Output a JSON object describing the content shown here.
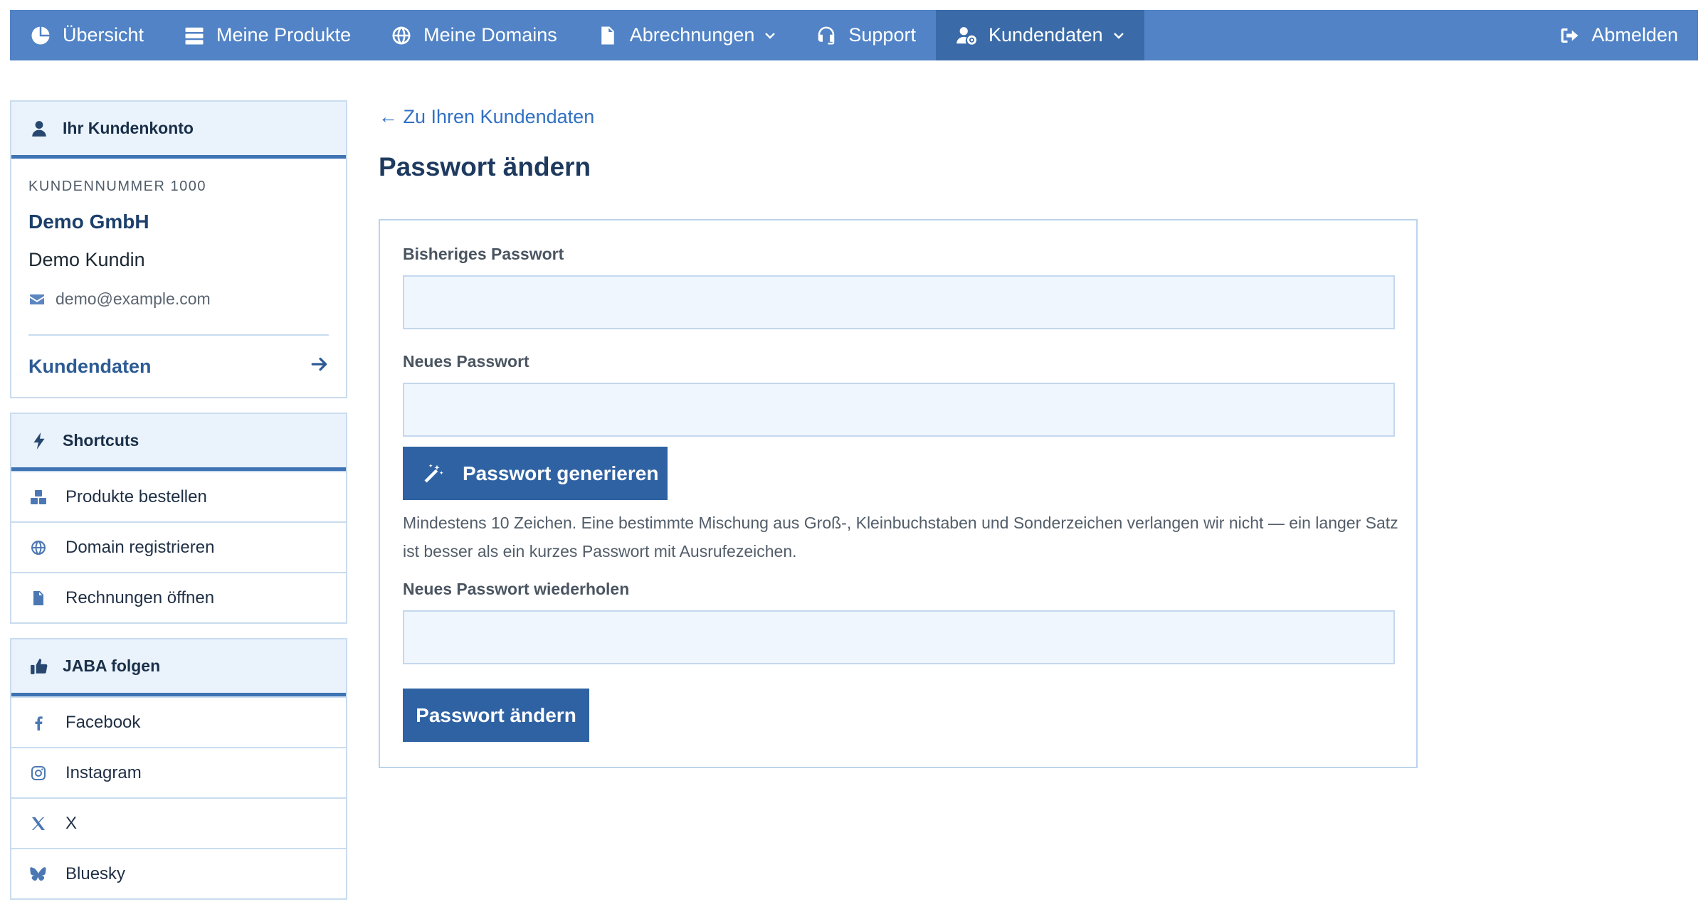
{
  "nav": {
    "items": [
      {
        "label": "Übersicht",
        "icon": "chart-pie-icon"
      },
      {
        "label": "Meine Produkte",
        "icon": "server-icon"
      },
      {
        "label": "Meine Domains",
        "icon": "globe-icon"
      },
      {
        "label": "Abrechnungen",
        "icon": "document-icon",
        "dropdown": true
      },
      {
        "label": "Support",
        "icon": "headset-icon"
      },
      {
        "label": "Kundendaten",
        "icon": "user-gear-icon",
        "dropdown": true,
        "active": true
      }
    ],
    "logout_label": "Abmelden",
    "bg_color": "#5183c6",
    "active_color": "#3a6ba8"
  },
  "sidebar": {
    "account": {
      "heading": "Ihr Kundenkonto",
      "customer_number": "KUNDENNUMMER 1000",
      "company": "Demo GmbH",
      "person": "Demo Kundin",
      "email": "demo@example.com",
      "link_label": "Kundendaten"
    },
    "shortcuts": {
      "heading": "Shortcuts",
      "items": [
        {
          "label": "Produkte bestellen",
          "icon": "boxes-icon"
        },
        {
          "label": "Domain registrieren",
          "icon": "globe-icon"
        },
        {
          "label": "Rechnungen öffnen",
          "icon": "document-icon"
        }
      ]
    },
    "social": {
      "heading": "JABA folgen",
      "items": [
        {
          "label": "Facebook",
          "icon": "facebook-icon"
        },
        {
          "label": "Instagram",
          "icon": "instagram-icon"
        },
        {
          "label": "X",
          "icon": "x-icon"
        },
        {
          "label": "Bluesky",
          "icon": "bluesky-icon"
        }
      ]
    }
  },
  "main": {
    "back_link": "← Zu Ihren Kundendaten",
    "title": "Passwort ändern",
    "form": {
      "current_label": "Bisheriges Passwort",
      "current_value": "",
      "new_label": "Neues Passwort",
      "new_value": "",
      "generate_label": "Passwort generieren",
      "hint": "Mindestens 10 Zeichen. Eine bestimmte Mischung aus Groß-, Kleinbuchstaben und Sonderzeichen verlangen wir nicht — ein langer Satz ist besser als ein kurzes Passwort mit Ausrufezeichen.",
      "repeat_label": "Neues Passwort wiederholen",
      "repeat_value": "",
      "submit_label": "Passwort ändern"
    },
    "accent_color": "#2f62a3"
  }
}
